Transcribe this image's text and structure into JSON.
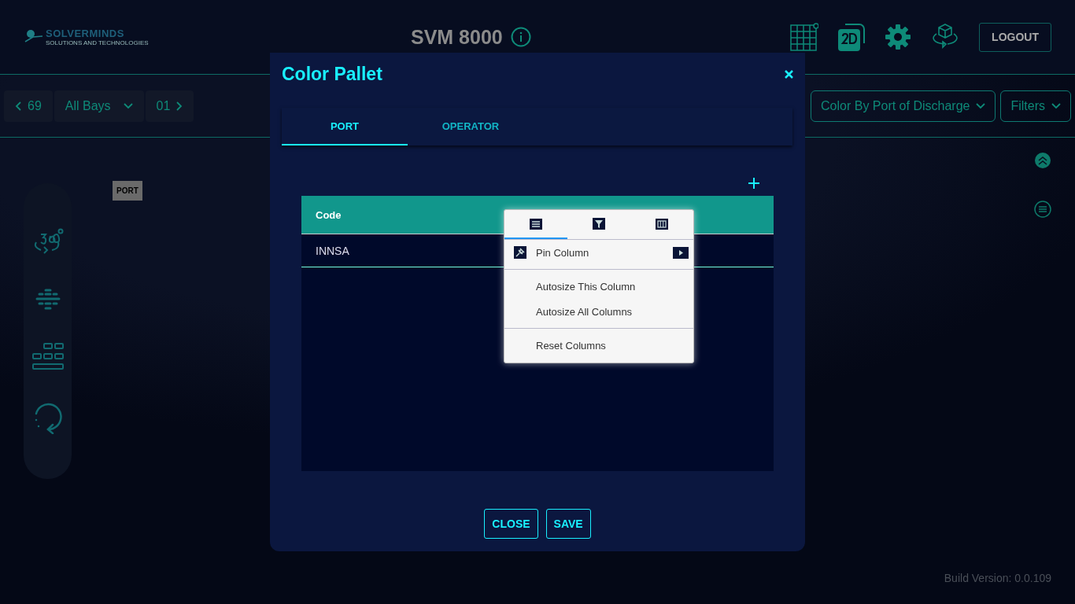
{
  "header": {
    "logo": {
      "name": "SOLVERMINDS",
      "tagline": "SOLUTIONS AND TECHNOLOGIES"
    },
    "title": "SVM 8000",
    "logout": "LOGOUT"
  },
  "toolbar": {
    "bay_prev": "69",
    "bays": "All Bays",
    "bay_next": "01",
    "color_by": "Color By Port of Discharge",
    "filters": "Filters"
  },
  "canvas_label": "PORT",
  "build_version": "Build Version: 0.0.109",
  "dialog": {
    "title": "Color Pallet",
    "tabs": [
      {
        "label": "PORT",
        "selected": true
      },
      {
        "label": "OPERATOR",
        "selected": false
      }
    ],
    "table": {
      "columns": [
        "Code"
      ],
      "rows": [
        [
          "INNSA"
        ]
      ]
    },
    "column_menu": {
      "tabs": [
        {
          "kind": "general",
          "selected": true
        },
        {
          "kind": "filter",
          "selected": false
        },
        {
          "kind": "columns",
          "selected": false
        }
      ],
      "items": [
        {
          "kind": "pin",
          "label": "Pin Column"
        },
        {
          "kind": "separator"
        },
        {
          "kind": "plain",
          "label": "Autosize This Column"
        },
        {
          "kind": "plain",
          "label": "Autosize All Columns"
        },
        {
          "kind": "separator"
        },
        {
          "kind": "plain",
          "label": "Reset Columns"
        }
      ]
    },
    "buttons": [
      "CLOSE",
      "SAVE"
    ]
  }
}
